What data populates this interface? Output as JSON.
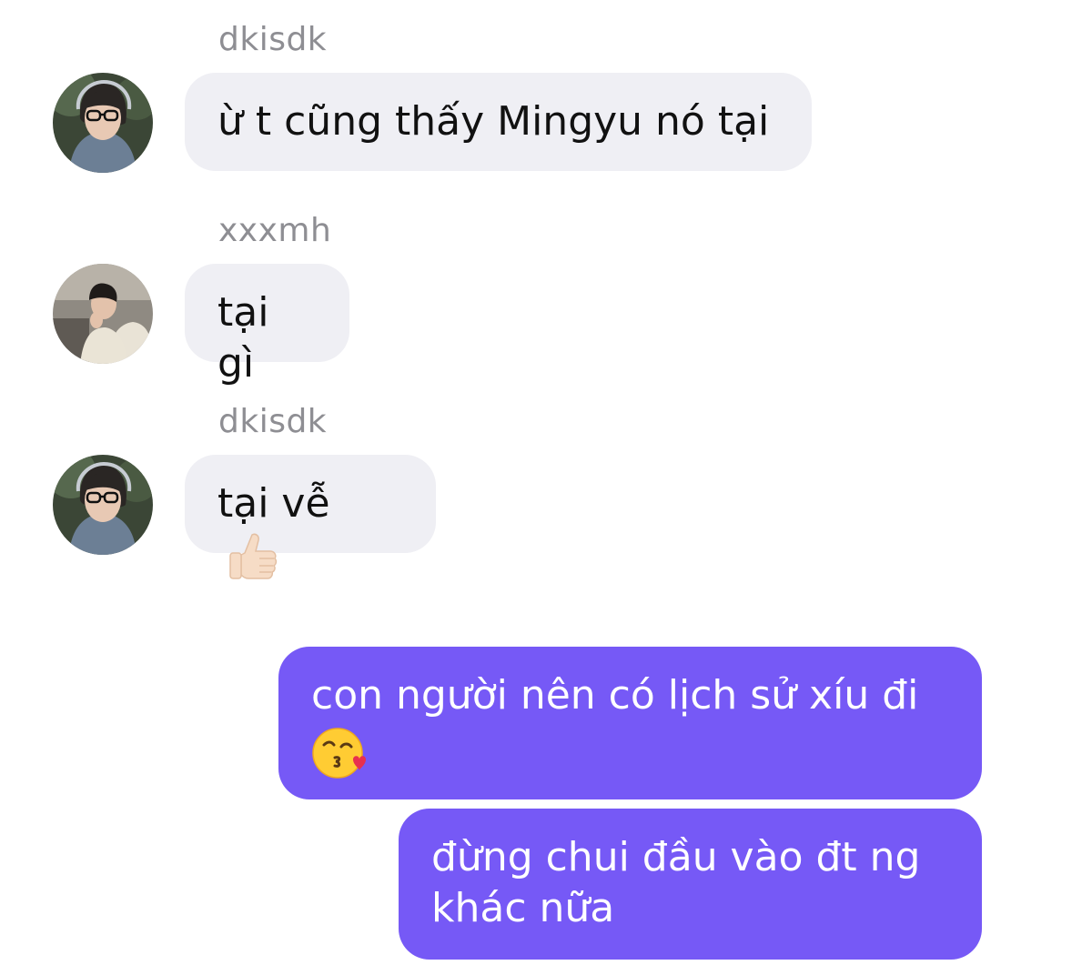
{
  "messages": [
    {
      "direction": "incoming",
      "sender": "dkisdk",
      "avatar": "avatar-dkisdk",
      "text": "ừ t cũng thấy Mingyu nó tại"
    },
    {
      "direction": "incoming",
      "sender": "xxxmh",
      "avatar": "avatar-xxxmh",
      "text": "tại gì"
    },
    {
      "direction": "incoming",
      "sender": "dkisdk",
      "avatar": "avatar-dkisdk",
      "text": "tại vễ",
      "emoji": "thumbs-up-icon"
    },
    {
      "direction": "outgoing",
      "line1": "con người nên có lịch sử xíu đi",
      "emoji": "face-blowing-kiss-icon"
    },
    {
      "direction": "outgoing",
      "line1": "đừng chui đầu vào đt ng",
      "line2": "khác nữa"
    }
  ],
  "colors": {
    "incoming_bubble": "#efeff4",
    "outgoing_bubble": "#7659f6",
    "sender_label": "#8e8e93"
  }
}
